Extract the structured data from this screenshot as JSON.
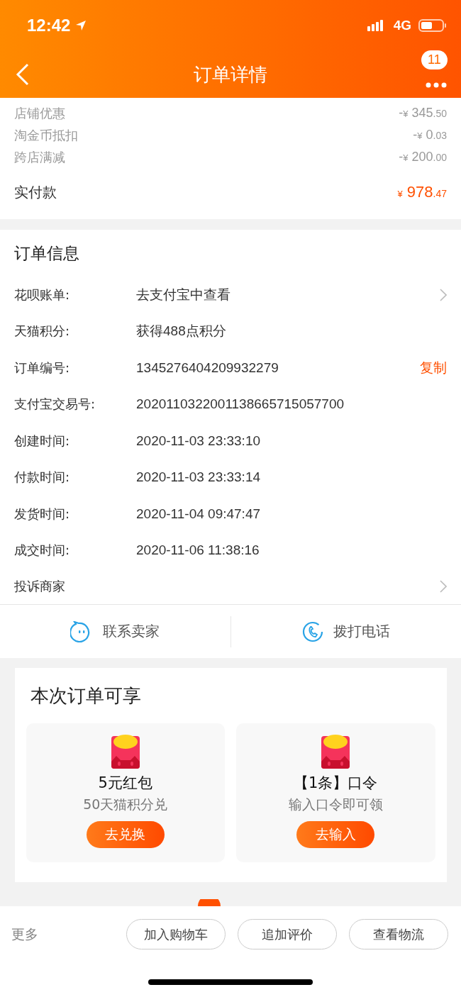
{
  "status_bar": {
    "time": "12:42",
    "network": "4G"
  },
  "nav": {
    "title": "订单详情",
    "badge": "11"
  },
  "discounts": [
    {
      "label": "店铺优惠",
      "sign": "-",
      "currency": "¥",
      "integer": "345",
      "decimal": ".50"
    },
    {
      "label": "淘金币抵扣",
      "sign": "-",
      "currency": "¥",
      "integer": "0",
      "decimal": ".03"
    },
    {
      "label": "跨店满减",
      "sign": "-",
      "currency": "¥",
      "integer": "200",
      "decimal": ".00"
    }
  ],
  "paid": {
    "label": "实付款",
    "currency": "¥",
    "integer": "978",
    "decimal": ".47"
  },
  "order_info": {
    "title": "订单信息",
    "rows": [
      {
        "kind": "link",
        "label": "花呗账单:",
        "value": "去支付宝中查看"
      },
      {
        "kind": "plain",
        "label": "天猫积分:",
        "value": "获得488点积分"
      },
      {
        "kind": "copy",
        "label": "订单编号:",
        "value": "1345276404209932279",
        "action": "复制"
      },
      {
        "kind": "plain",
        "label": "支付宝交易号:",
        "value": "2020110322001138665715057700"
      },
      {
        "kind": "plain",
        "label": "创建时间:",
        "value": "2020-11-03 23:33:10"
      },
      {
        "kind": "plain",
        "label": "付款时间:",
        "value": "2020-11-03 23:33:14"
      },
      {
        "kind": "plain",
        "label": "发货时间:",
        "value": "2020-11-04 09:47:47"
      },
      {
        "kind": "plain",
        "label": "成交时间:",
        "value": "2020-11-06 11:38:16"
      },
      {
        "kind": "link",
        "label": "投诉商家"
      }
    ]
  },
  "contact": [
    {
      "kind": "chat",
      "label": "联系卖家"
    },
    {
      "kind": "phone",
      "label": "拨打电话"
    }
  ],
  "benefits": {
    "title": "本次订单可享",
    "items": [
      {
        "title": "5元红包",
        "subtitle": "50天猫积分兑",
        "button": "去兑换"
      },
      {
        "title": "【1条】口令",
        "subtitle": "输入口令即可领",
        "button": "去输入"
      }
    ]
  },
  "bottom_bar": {
    "more": "更多",
    "buttons": [
      "加入购物车",
      "追加评价",
      "查看物流"
    ]
  }
}
